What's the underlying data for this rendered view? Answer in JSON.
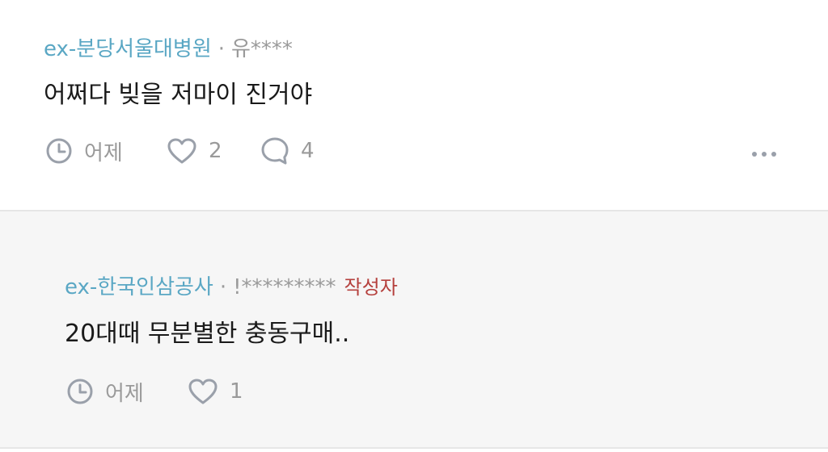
{
  "comments": [
    {
      "company": "ex-분당서울대병원",
      "separator": "·",
      "user": "유****",
      "author_tag": "",
      "text": "어쩌다 빚을 저마이 진거야",
      "time": "어제",
      "likes": "2",
      "replies": "4"
    },
    {
      "company": "ex-한국인삼공사",
      "separator": "·",
      "user": "!*********",
      "author_tag": "작성자",
      "text": "20대때 무분별한 충동구매..",
      "time": "어제",
      "likes": "1"
    }
  ],
  "icons": {
    "time": "clock-icon",
    "like": "heart-icon",
    "reply": "speech-bubble-icon",
    "more": "more-dots-icon"
  },
  "colors": {
    "company": "#5aa7c4",
    "author_tag": "#b5403d",
    "muted": "#9a9a9a",
    "reply_background": "#f6f6f6"
  }
}
